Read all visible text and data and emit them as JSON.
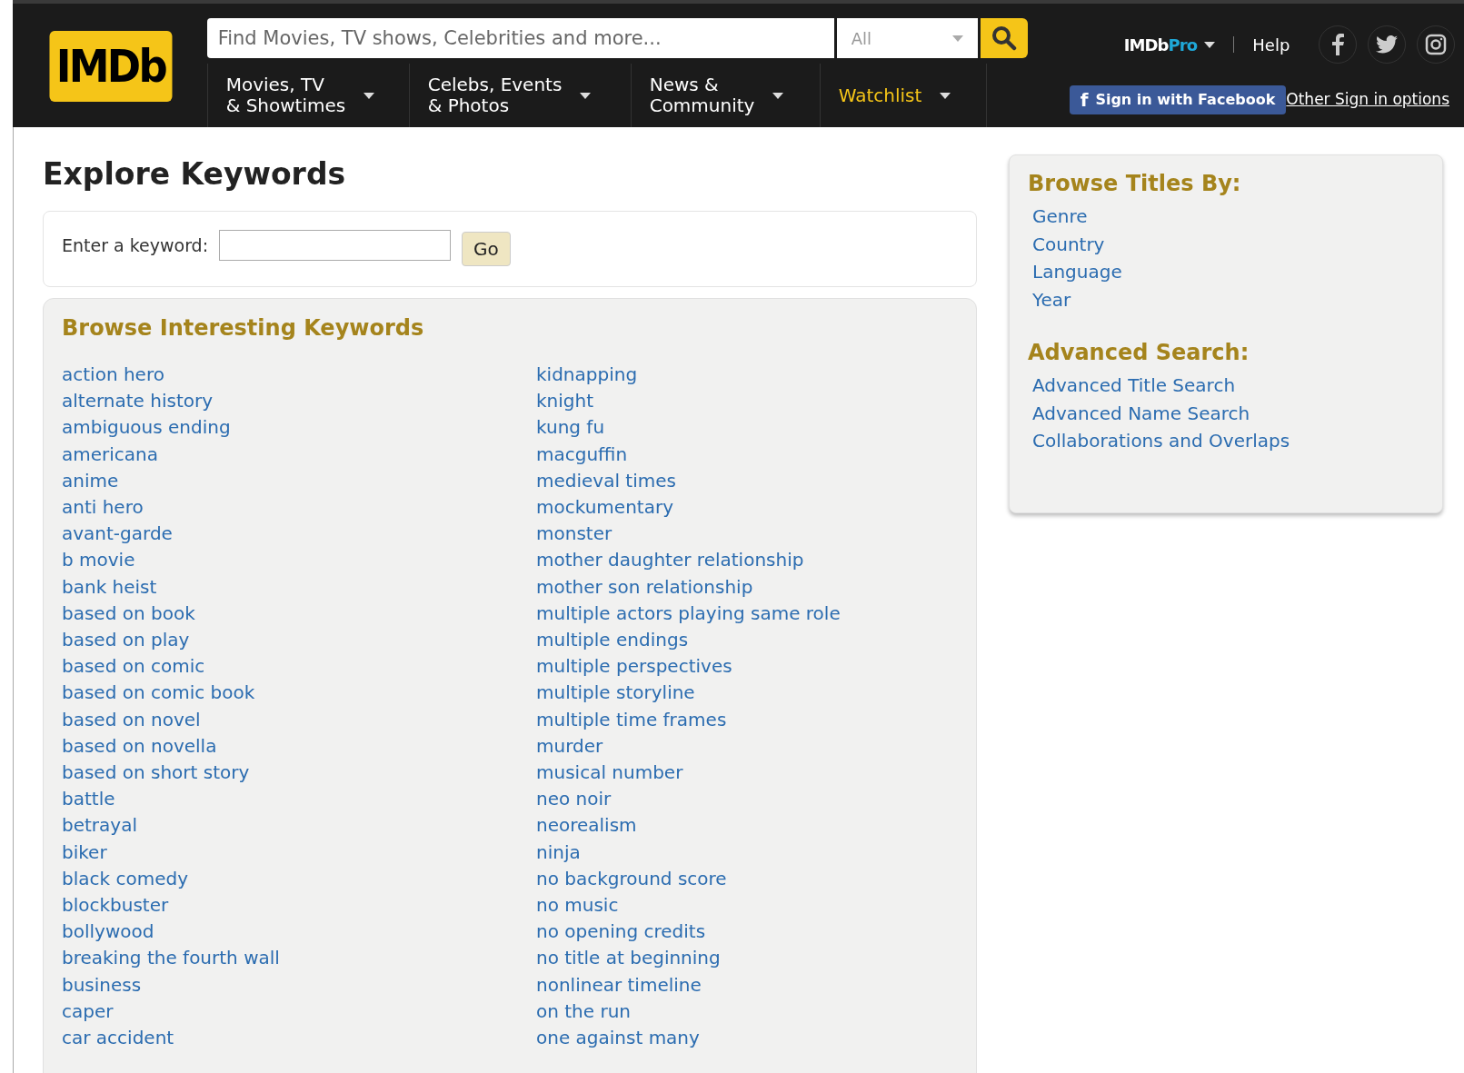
{
  "header": {
    "logo": "IMDb",
    "search": {
      "placeholder": "Find Movies, TV shows, Celebrities and more...",
      "category": "All"
    },
    "nav": [
      {
        "lines": [
          "Movies, TV",
          "& Showtimes"
        ],
        "highlighted": false
      },
      {
        "lines": [
          "Celebs, Events",
          "& Photos"
        ],
        "highlighted": false
      },
      {
        "lines": [
          "News &",
          "Community"
        ],
        "highlighted": false
      },
      {
        "lines": [
          "Watchlist"
        ],
        "highlighted": true
      }
    ],
    "imdbpro": {
      "brand": "IMDb",
      "suffix": "Pro"
    },
    "help": "Help",
    "facebook_button": "Sign in with Facebook",
    "facebook_glyph": "f",
    "other_sign_in": "Other Sign in options"
  },
  "page_title": "Explore Keywords",
  "keyword_form": {
    "label": "Enter a keyword:",
    "button": "Go"
  },
  "browse_keywords": {
    "title": "Browse Interesting Keywords",
    "columns": [
      [
        "action hero",
        "alternate history",
        "ambiguous ending",
        "americana",
        "anime",
        "anti hero",
        "avant-garde",
        "b movie",
        "bank heist",
        "based on book",
        "based on play",
        "based on comic",
        "based on comic book",
        "based on novel",
        "based on novella",
        "based on short story",
        "battle",
        "betrayal",
        "biker",
        "black comedy",
        "blockbuster",
        "bollywood",
        "breaking the fourth wall",
        "business",
        "caper",
        "car accident"
      ],
      [
        "kidnapping",
        "knight",
        "kung fu",
        "macguffin",
        "medieval times",
        "mockumentary",
        "monster",
        "mother daughter relationship",
        "mother son relationship",
        "multiple actors playing same role",
        "multiple endings",
        "multiple perspectives",
        "multiple storyline",
        "multiple time frames",
        "murder",
        "musical number",
        "neo noir",
        "neorealism",
        "ninja",
        "no background score",
        "no music",
        "no opening credits",
        "no title at beginning",
        "nonlinear timeline",
        "on the run",
        "one against many"
      ]
    ]
  },
  "sidebar": [
    {
      "title": "Browse Titles By:",
      "links": [
        "Genre",
        "Country",
        "Language",
        "Year"
      ]
    },
    {
      "title": "Advanced Search:",
      "links": [
        "Advanced Title Search",
        "Advanced Name Search",
        "Collaborations and Overlaps"
      ]
    }
  ]
}
